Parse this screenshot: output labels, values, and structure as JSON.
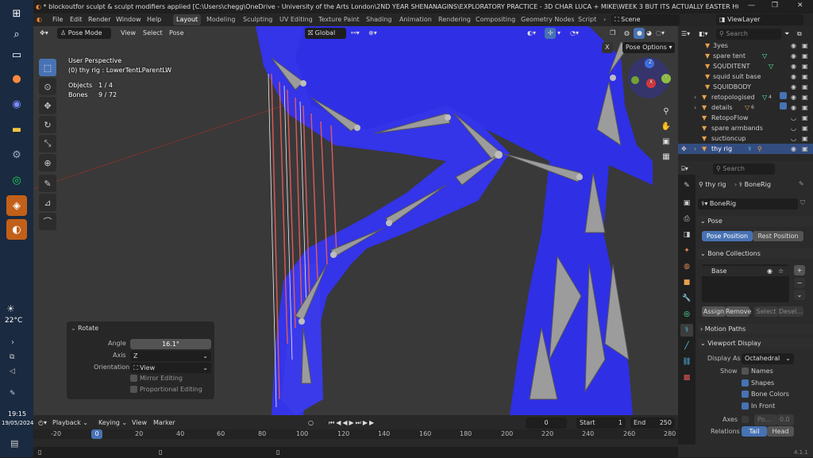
{
  "window": {
    "title": "* blockoutfor sculpt & sculpt modifiers applied [C:\\Users\\chegg\\OneDrive - University of the Arts London\\2ND YEAR SHENANAGINS\\EXPLORATORY PRACTICE - 3D CHAR LUCA + MIKE\\WEEK 3 BUT ITS ACTUALLY EASTER HOLIDAYS IM LAZY\\block..."
  },
  "taskbar": {
    "weather_temp": "22°C",
    "time": "19:15",
    "date": "19/05/2024"
  },
  "menu": {
    "file": "File",
    "edit": "Edit",
    "render": "Render",
    "window": "Window",
    "help": "Help"
  },
  "workspaces": [
    "Layout",
    "Modeling",
    "Sculpting",
    "UV Editing",
    "Texture Paint",
    "Shading",
    "Animation",
    "Rendering",
    "Compositing",
    "Geometry Nodes",
    "Scriptin"
  ],
  "scene": {
    "label": "Scene",
    "view_layer": "ViewLayer"
  },
  "viewport_header": {
    "mode": "Pose Mode",
    "view": "View",
    "select": "Select",
    "pose": "Pose",
    "orientation": "Global",
    "pose_options": "Pose Options"
  },
  "viewport_info": {
    "perspective": "User Perspective",
    "active": "(0) thy rig : LowerTentLParentLW",
    "objects_label": "Objects",
    "objects_value": "1 / 4",
    "bones_label": "Bones",
    "bones_value": "9 / 72"
  },
  "gizmo": {
    "x": "X",
    "y": "Y",
    "z": "Z"
  },
  "rotate_panel": {
    "title": "Rotate",
    "angle_label": "Angle",
    "angle_value": "16.1°",
    "axis_label": "Axis",
    "axis_value": "Z",
    "orientation_label": "Orientation",
    "orientation_value": "View",
    "mirror": "Mirror Editing",
    "proportional": "Proportional Editing"
  },
  "timeline": {
    "playback": "Playback",
    "keying": "Keying",
    "view": "View",
    "marker": "Marker",
    "current_frame": "0",
    "start_label": "Start",
    "start": "1",
    "end_label": "End",
    "end": "250",
    "ruler": [
      "-20",
      "0",
      "20",
      "40",
      "60",
      "80",
      "100",
      "120",
      "140",
      "160",
      "180",
      "200",
      "220",
      "240",
      "260",
      "280"
    ]
  },
  "outliner": {
    "search_placeholder": "Search",
    "items": [
      {
        "name": "3yes"
      },
      {
        "name": "spare tent"
      },
      {
        "name": "SQUDITENT"
      },
      {
        "name": "squid suit base"
      },
      {
        "name": "SQUIDBODY"
      },
      {
        "name": "retopologised",
        "badge": "4"
      },
      {
        "name": "details",
        "badge": "6"
      },
      {
        "name": "RetopoFlow"
      },
      {
        "name": "spare armbands"
      },
      {
        "name": "suctioncup"
      },
      {
        "name": "thy rig"
      }
    ]
  },
  "properties": {
    "search_placeholder": "Search",
    "breadcrumb_object": "thy rig",
    "breadcrumb_data": "BoneRig",
    "data_name": "BoneRig",
    "pose_section": "Pose",
    "pose_position": "Pose Position",
    "rest_position": "Rest Position",
    "bone_collections": "Bone Collections",
    "collection_base": "Base",
    "assign": "Assign",
    "remove": "Remove",
    "select": "Select",
    "deselect": "Desel...",
    "motion_paths": "Motion Paths",
    "viewport_display": "Viewport Display",
    "display_as_label": "Display As",
    "display_as_value": "Octahedral",
    "show_label": "Show",
    "names": "Names",
    "shapes": "Shapes",
    "bone_colors": "Bone Colors",
    "in_front": "In Front",
    "axes_label": "Axes",
    "axes_pos": "Po...",
    "axes_value": "0.0",
    "relations_label": "Relations",
    "tail": "Tail",
    "head": "Head"
  },
  "version": "4.1.1",
  "colors": {
    "accent": "#4772b3",
    "mesh": "#2a2ae8",
    "taskbar": "#1a2a40",
    "active_app": "#c26019"
  }
}
